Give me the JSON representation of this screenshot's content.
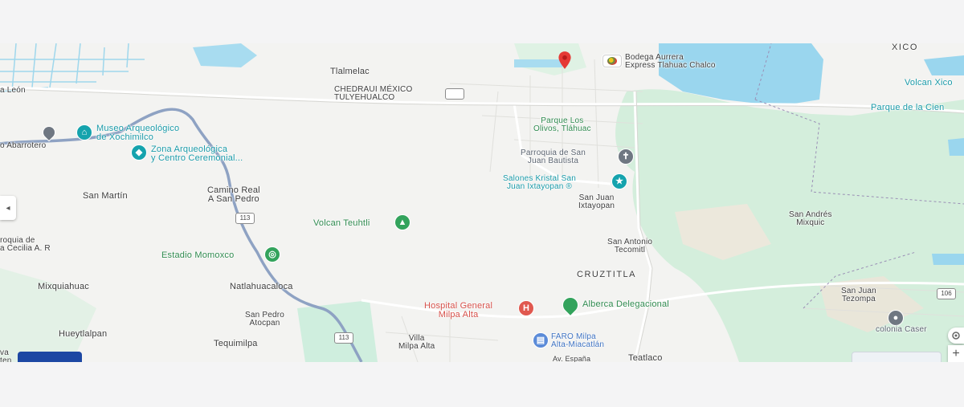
{
  "map": {
    "places": {
      "tlalmelac": "Tlalmelac",
      "chedraui_1": "CHEDRAUI MÉXICO",
      "chedraui_2": "TULYEHUALCO",
      "xico": "XICO",
      "volcan_xico": "Volcan Xico",
      "parque_ciencia": "Parque de la Cien",
      "bodega_1": "Bodega Aurrera",
      "bodega_2": "Express Tlahuac Chalco",
      "parque_olivos_1": "Parque Los",
      "parque_olivos_2": "Olivos, Tláhuac",
      "parroquia_1": "Parroquia de San",
      "parroquia_2": "Juan Bautista",
      "salones_1": "Salones Kristal San",
      "salones_2": "Juan Ixtayopan ®",
      "sj_ixtayopan_1": "San Juan",
      "sj_ixtayopan_2": "Ixtayopan",
      "museo_1": "Museo Arqueológico",
      "museo_2": "de Xochimilco",
      "zona_1": "Zona Arqueológica",
      "zona_2": "y Centro Ceremonial...",
      "abarrotero": "o Abarrotero",
      "leon": "a León",
      "san_martin": "San Martín",
      "camino_1": "Camino Real",
      "camino_2": "A San Pedro",
      "volcan_teuhtli": "Volcan Teuhtli",
      "san_andres_1": "San Andrés",
      "san_andres_2": "Mixquic",
      "san_antonio_1": "San Antonio",
      "san_antonio_2": "Tecomitl",
      "parroquia_cecilia_1": "roquia de",
      "parroquia_cecilia_2": "a Cecilia A. R",
      "estadio": "Estadio Momoxco",
      "cruztitla": "CRUZTITLA",
      "mixquiahuac": "Mixquiahuac",
      "natlahuacaloca": "Natlahuacaloca",
      "san_juan_tezompa_1": "San Juan",
      "san_juan_tezompa_2": "Tezompa",
      "hospital_1": "Hospital General",
      "hospital_2": "Milpa Alta",
      "alberca": "Alberca Delegacional",
      "san_pedro_1": "San Pedro",
      "san_pedro_2": "Atocpan",
      "colonia": "colonia Caser",
      "hueytlalpan": "Hueytlalpan",
      "villa_1": "Villa",
      "villa_2": "Milpa Alta",
      "faro_1": "FARO Milpa",
      "faro_2": "Alta-Miacatlán",
      "tequimilpa": "Tequimilpa",
      "teatlaco": "Teatlaco",
      "av_espana": "Av. España",
      "edge_va": "va",
      "edge_ten": "ten"
    },
    "shields": {
      "route_113a": "113",
      "route_113b": "113",
      "route_106": "106"
    },
    "controls": {
      "collapse": "◂",
      "zoom_in": "+"
    },
    "colors": {
      "water": "#9bd7ee",
      "park": "#cfecd7",
      "highway": "#8aa0c0",
      "pin": "#e53935",
      "land": "#f3f3f1"
    }
  }
}
